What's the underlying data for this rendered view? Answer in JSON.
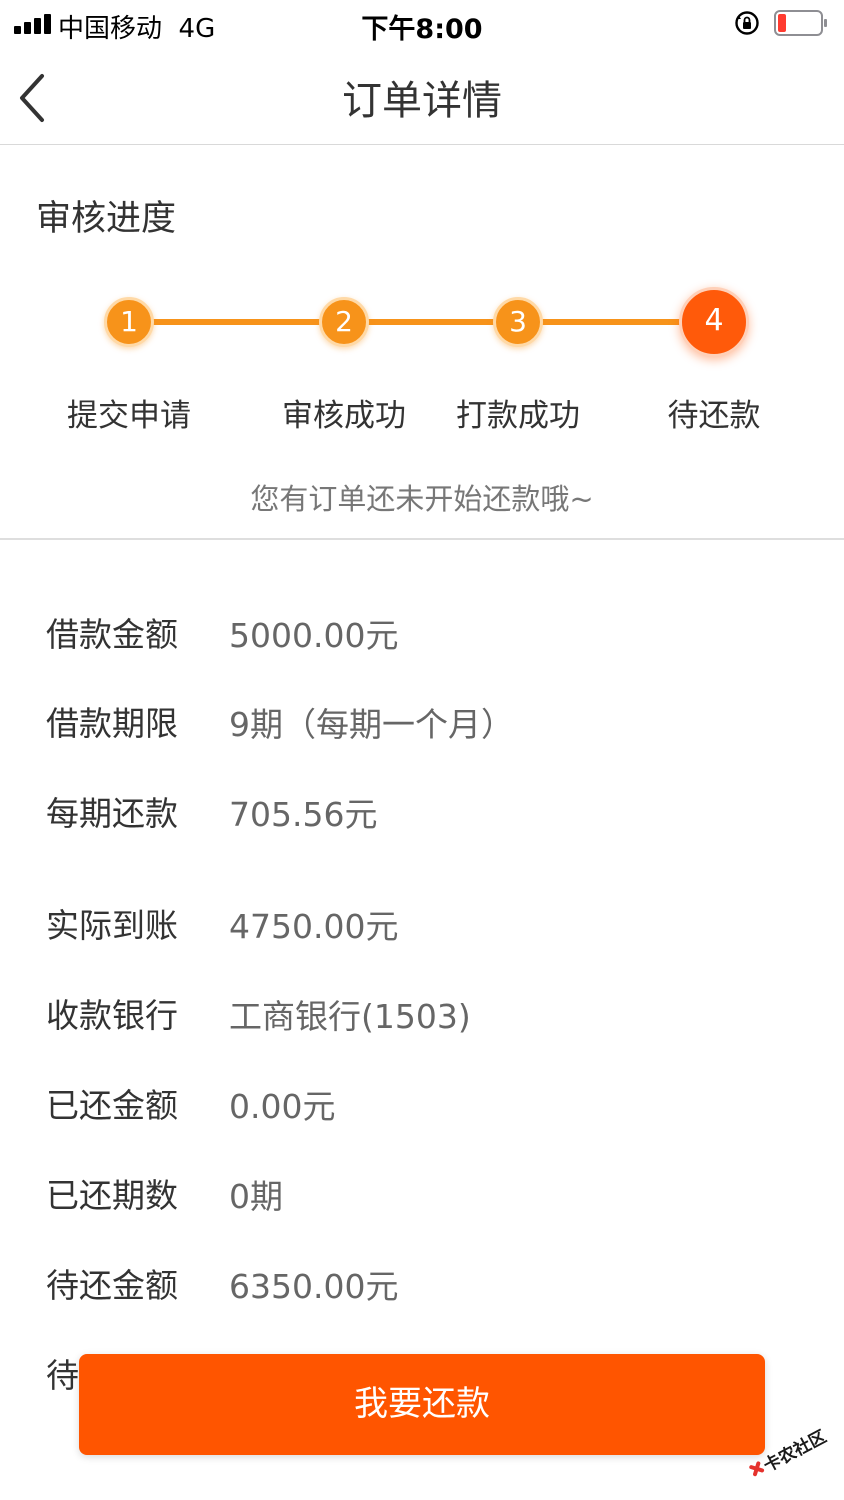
{
  "status_bar": {
    "carrier": "中国移动",
    "network": "4G",
    "time": "下午8:00"
  },
  "nav": {
    "title": "订单详情"
  },
  "progress": {
    "title": "审核进度",
    "steps": [
      {
        "number": "1",
        "label": "提交申请"
      },
      {
        "number": "2",
        "label": "审核成功"
      },
      {
        "number": "3",
        "label": "打款成功"
      },
      {
        "number": "4",
        "label": "待还款"
      }
    ],
    "current_step": 4,
    "hint": "您有订单还未开始还款哦~"
  },
  "details": [
    {
      "label": "借款金额",
      "value": "5000.00元"
    },
    {
      "label": "借款期限",
      "value": "9期（每期一个月）"
    },
    {
      "label": "每期还款",
      "value": "705.56元"
    },
    {
      "label": "实际到账",
      "value": "4750.00元"
    },
    {
      "label": "收款银行",
      "value": "工商银行(1503)"
    },
    {
      "label": "已还金额",
      "value": "0.00元"
    },
    {
      "label": "已还期数",
      "value": "0期"
    },
    {
      "label": "待还金额",
      "value": "6350.00元"
    },
    {
      "label": "待",
      "value": ""
    }
  ],
  "repay_button": {
    "label": "我要还款"
  },
  "watermark": {
    "text": "卡农社区"
  },
  "colors": {
    "accent": "#f7931a",
    "current_step": "#ff5a0a",
    "button": "#ff5500",
    "battery_low": "#ff3b30"
  }
}
